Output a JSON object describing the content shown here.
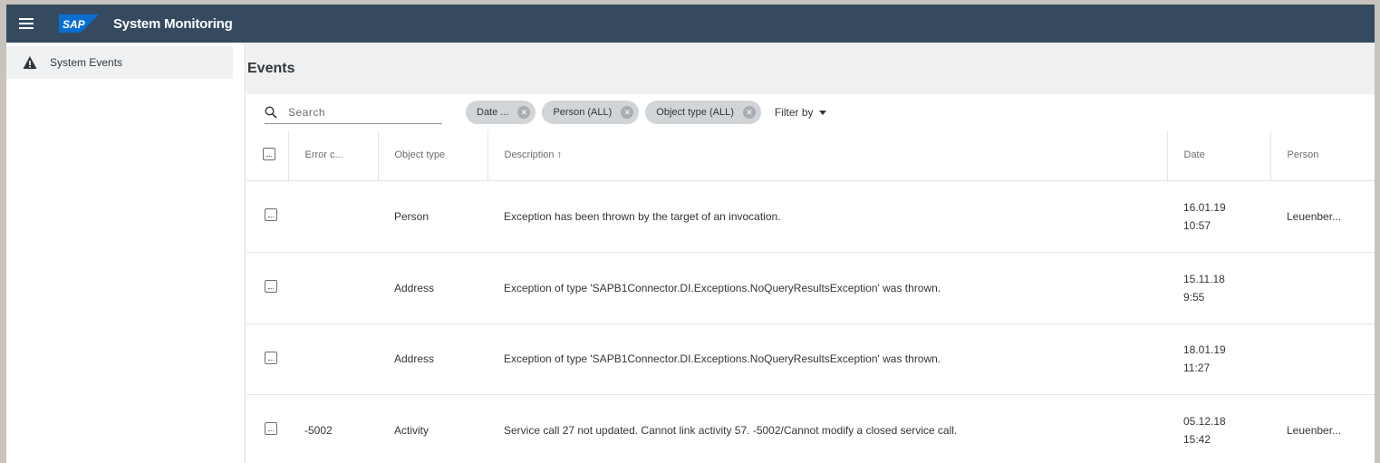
{
  "header": {
    "logo_text": "SAP",
    "title": "System Monitoring"
  },
  "sidebar": {
    "items": [
      {
        "label": "System Events",
        "icon": "warning-icon"
      }
    ]
  },
  "page": {
    "title": "Events"
  },
  "toolbar": {
    "search_placeholder": "Search",
    "filters": [
      {
        "label": "Date ..."
      },
      {
        "label": "Person (ALL)"
      },
      {
        "label": "Object type (ALL)"
      }
    ],
    "filter_by_label": "Filter by"
  },
  "table": {
    "columns": [
      "Error c...",
      "Object type",
      "Description ↑",
      "Date",
      "Person"
    ],
    "rows": [
      {
        "error_code": "",
        "object_type": "Person",
        "description": "Exception has been thrown by the target of an invocation.",
        "date": "16.01.19",
        "time": "10:57",
        "person": "Leuenber..."
      },
      {
        "error_code": "",
        "object_type": "Address",
        "description": "Exception of type 'SAPB1Connector.DI.Exceptions.NoQueryResultsException' was thrown.",
        "date": "15.11.18",
        "time": "9:55",
        "person": ""
      },
      {
        "error_code": "",
        "object_type": "Address",
        "description": "Exception of type 'SAPB1Connector.DI.Exceptions.NoQueryResultsException' was thrown.",
        "date": "18.01.19",
        "time": "11:27",
        "person": ""
      },
      {
        "error_code": "-5002",
        "object_type": "Activity",
        "description": "Service call 27 not updated. Cannot link activity 57. -5002/Cannot modify a closed service call.",
        "date": "05.12.18",
        "time": "15:42",
        "person": "Leuenber..."
      }
    ]
  },
  "colors": {
    "shell_bar": "#354a5f",
    "sap_logo": "#0a6ed1",
    "page_header_bg": "#eef0f1",
    "chip_bg": "#d1d5d8"
  }
}
